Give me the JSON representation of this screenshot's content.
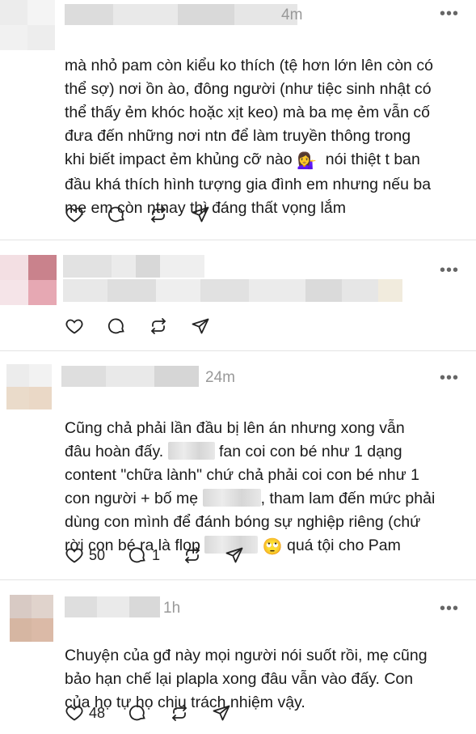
{
  "posts": [
    {
      "time": "4m",
      "more": "•••",
      "lines": [
        "mà nhỏ pam còn kiểu ko thích (tệ hơn lớn lên còn có",
        "thể sợ) nơi ồn ào, đông người (như tiệc sinh nhật có",
        "thể thấy ẻm khóc hoặc xịt keo) mà ba mẹ ẻm vẫn cố",
        "đưa đến những nơi ntn để làm truyền thông trong",
        "khi biết impact ẻm khủng cỡ nào",
        "nói thiệt t ban",
        "đầu khá thích hình tượng gia đình em nhưng nếu ba",
        "mẹ em còn ntnay thì đáng thất vọng lắm"
      ],
      "emoji": "💁‍♀️",
      "likes": "",
      "replies": ""
    },
    {
      "time": "",
      "more": "•••",
      "lines": [],
      "likes": "",
      "replies": ""
    },
    {
      "time": "24m",
      "more": "•••",
      "lines": [
        "Cũng chả phải lần đầu bị lên án nhưng xong vẫn",
        "đâu hoàn đấy.",
        "fan coi con bé như 1 dạng",
        "content \"chữa lành\" chứ chả phải coi con bé như 1",
        "con người + bố mẹ",
        ", tham lam đến mức phải",
        "dùng con mình để đánh bóng sự nghiệp riêng (chứ",
        "rời con bé ra là flop",
        "quá tội cho Pam"
      ],
      "emoji": "🙄",
      "likes": "50",
      "replies": "1"
    },
    {
      "time": "1h",
      "more": "•••",
      "lines": [
        "Chuyện của gđ này mọi người nói suốt rồi, mẹ cũng",
        "bảo hạn chế lại plapla xong đâu vẫn vào đấy. Con",
        "của họ tự họ chịu trách nhiệm vậy."
      ],
      "likes": "48",
      "replies": ""
    }
  ],
  "icons": [
    "heart-icon",
    "comment-icon",
    "repost-icon",
    "share-icon"
  ],
  "colors": {
    "text": "#1a1a1a",
    "muted": "#999999",
    "divider": "#e3e3e3"
  }
}
